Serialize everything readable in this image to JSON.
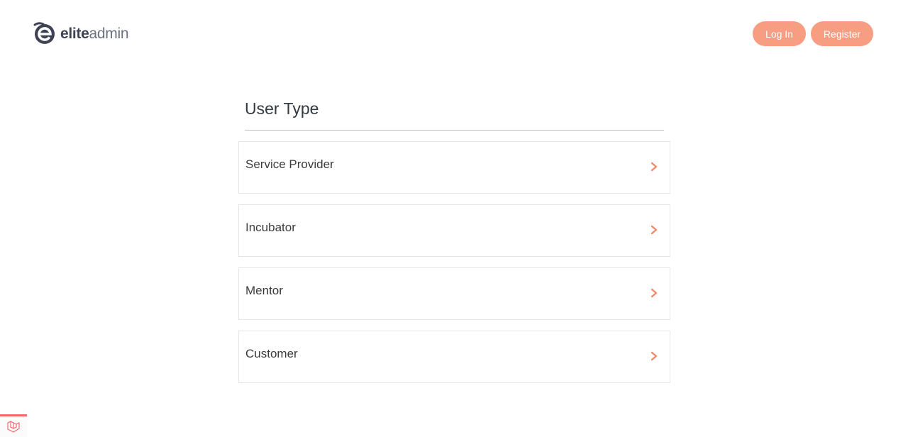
{
  "brand": {
    "name_bold": "elite",
    "name_light": "admin"
  },
  "header": {
    "login_label": "Log In",
    "register_label": "Register"
  },
  "main": {
    "title": "User Type",
    "options": [
      {
        "label": "Service Provider"
      },
      {
        "label": "Incubator"
      },
      {
        "label": "Mentor"
      },
      {
        "label": "Customer"
      }
    ]
  },
  "colors": {
    "accent": "#f79e82",
    "chevron": "#ef8a6c",
    "badge": "#f06a6a"
  },
  "icons": {
    "logo": "elite-e-logo-icon",
    "chevron": "chevron-right-icon",
    "badge": "laravel-icon"
  }
}
